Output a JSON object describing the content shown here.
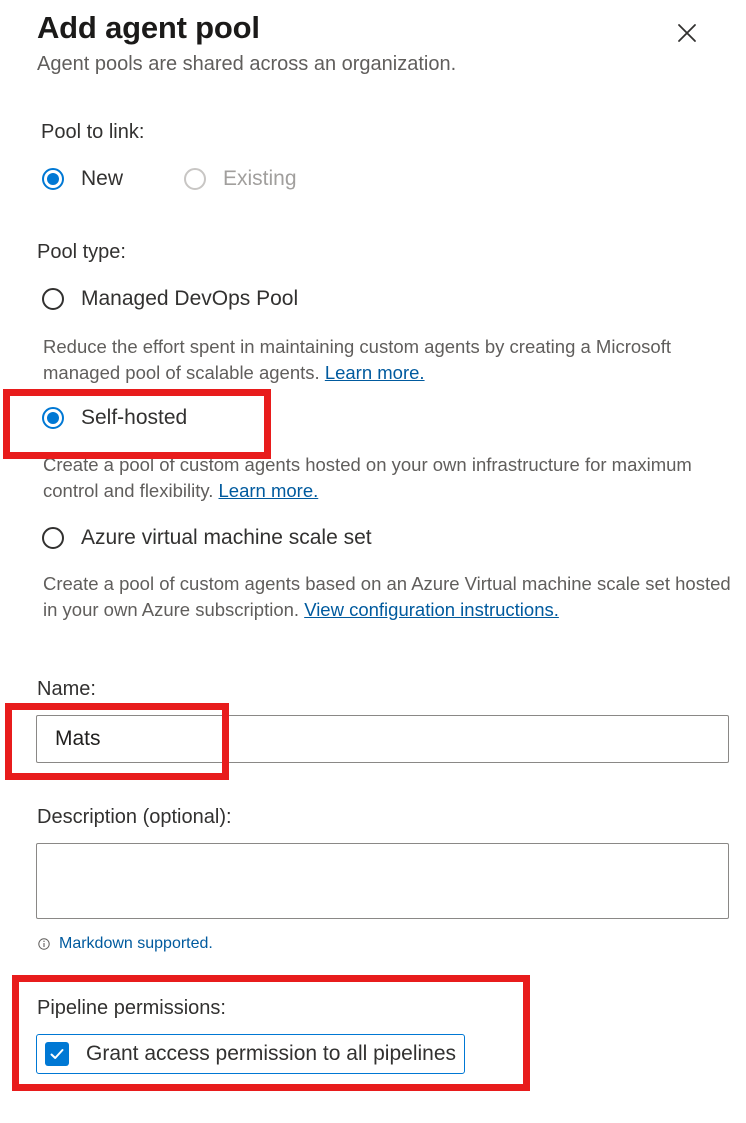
{
  "panel": {
    "title": "Add agent pool",
    "subtitle": "Agent pools are shared across an organization."
  },
  "icons": {
    "close": "close-icon",
    "info": "info-icon",
    "check": "checkmark-icon"
  },
  "pool_link": {
    "label": "Pool to link:",
    "options": [
      {
        "label": "New",
        "selected": true,
        "disabled": false
      },
      {
        "label": "Existing",
        "selected": false,
        "disabled": true
      }
    ]
  },
  "pool_type": {
    "label": "Pool type:",
    "options": [
      {
        "label": "Managed DevOps Pool",
        "selected": false,
        "description": "Reduce the effort spent in maintaining custom agents by creating a Microsoft managed pool of scalable agents.",
        "link": "Learn more."
      },
      {
        "label": "Self-hosted",
        "selected": true,
        "description": "Create a pool of custom agents hosted on your own infrastructure for maximum control and flexibility.",
        "link": "Learn more."
      },
      {
        "label": "Azure virtual machine scale set",
        "selected": false,
        "description": "Create a pool of custom agents based on an Azure Virtual machine scale set hosted in your own Azure subscription.",
        "link": "View configuration instructions."
      }
    ]
  },
  "name_field": {
    "label": "Name:",
    "value": "Mats"
  },
  "description_field": {
    "label": "Description (optional):",
    "value": "",
    "note": "Markdown supported."
  },
  "pipeline_permissions": {
    "label": "Pipeline permissions:",
    "checkbox_label": "Grant access permission to all pipelines",
    "checked": true
  },
  "colors": {
    "accent": "#0078d4",
    "link": "#005a9e",
    "highlight": "#e81c1c"
  }
}
